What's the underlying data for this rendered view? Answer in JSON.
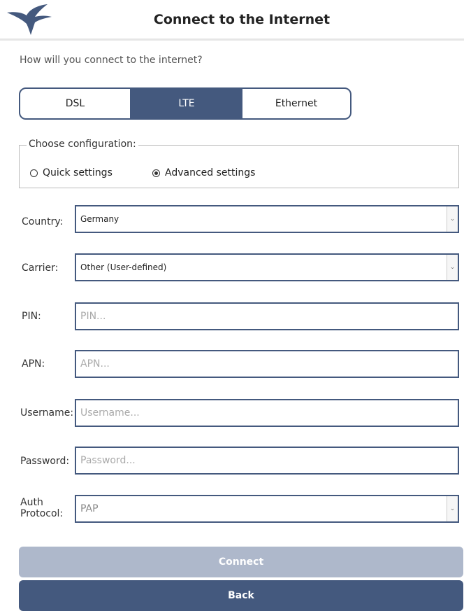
{
  "header": {
    "title": "Connect to the Internet"
  },
  "question": "How will you connect to the internet?",
  "connection_types": [
    {
      "label": "DSL",
      "selected": false
    },
    {
      "label": "LTE",
      "selected": true
    },
    {
      "label": "Ethernet",
      "selected": false
    }
  ],
  "configuration": {
    "legend": "Choose configuration:",
    "options": [
      {
        "label": "Quick settings",
        "checked": false
      },
      {
        "label": "Advanced settings",
        "checked": true
      }
    ]
  },
  "form": {
    "country": {
      "label": "Country:",
      "value": "Germany"
    },
    "carrier": {
      "label": "Carrier:",
      "value": "Other (User-defined)"
    },
    "pin": {
      "label": "PIN:",
      "placeholder": "PIN..."
    },
    "apn": {
      "label": "APN:",
      "placeholder": "APN..."
    },
    "username": {
      "label": "Username:",
      "placeholder": "Username..."
    },
    "password": {
      "label": "Password:",
      "placeholder": "Password..."
    },
    "auth_protocol": {
      "label_line1": "Auth",
      "label_line2": "Protocol:",
      "value": "PAP"
    }
  },
  "buttons": {
    "connect": "Connect",
    "back": "Back"
  },
  "colors": {
    "accent": "#44597e",
    "disabled": "#aeb8cb"
  }
}
